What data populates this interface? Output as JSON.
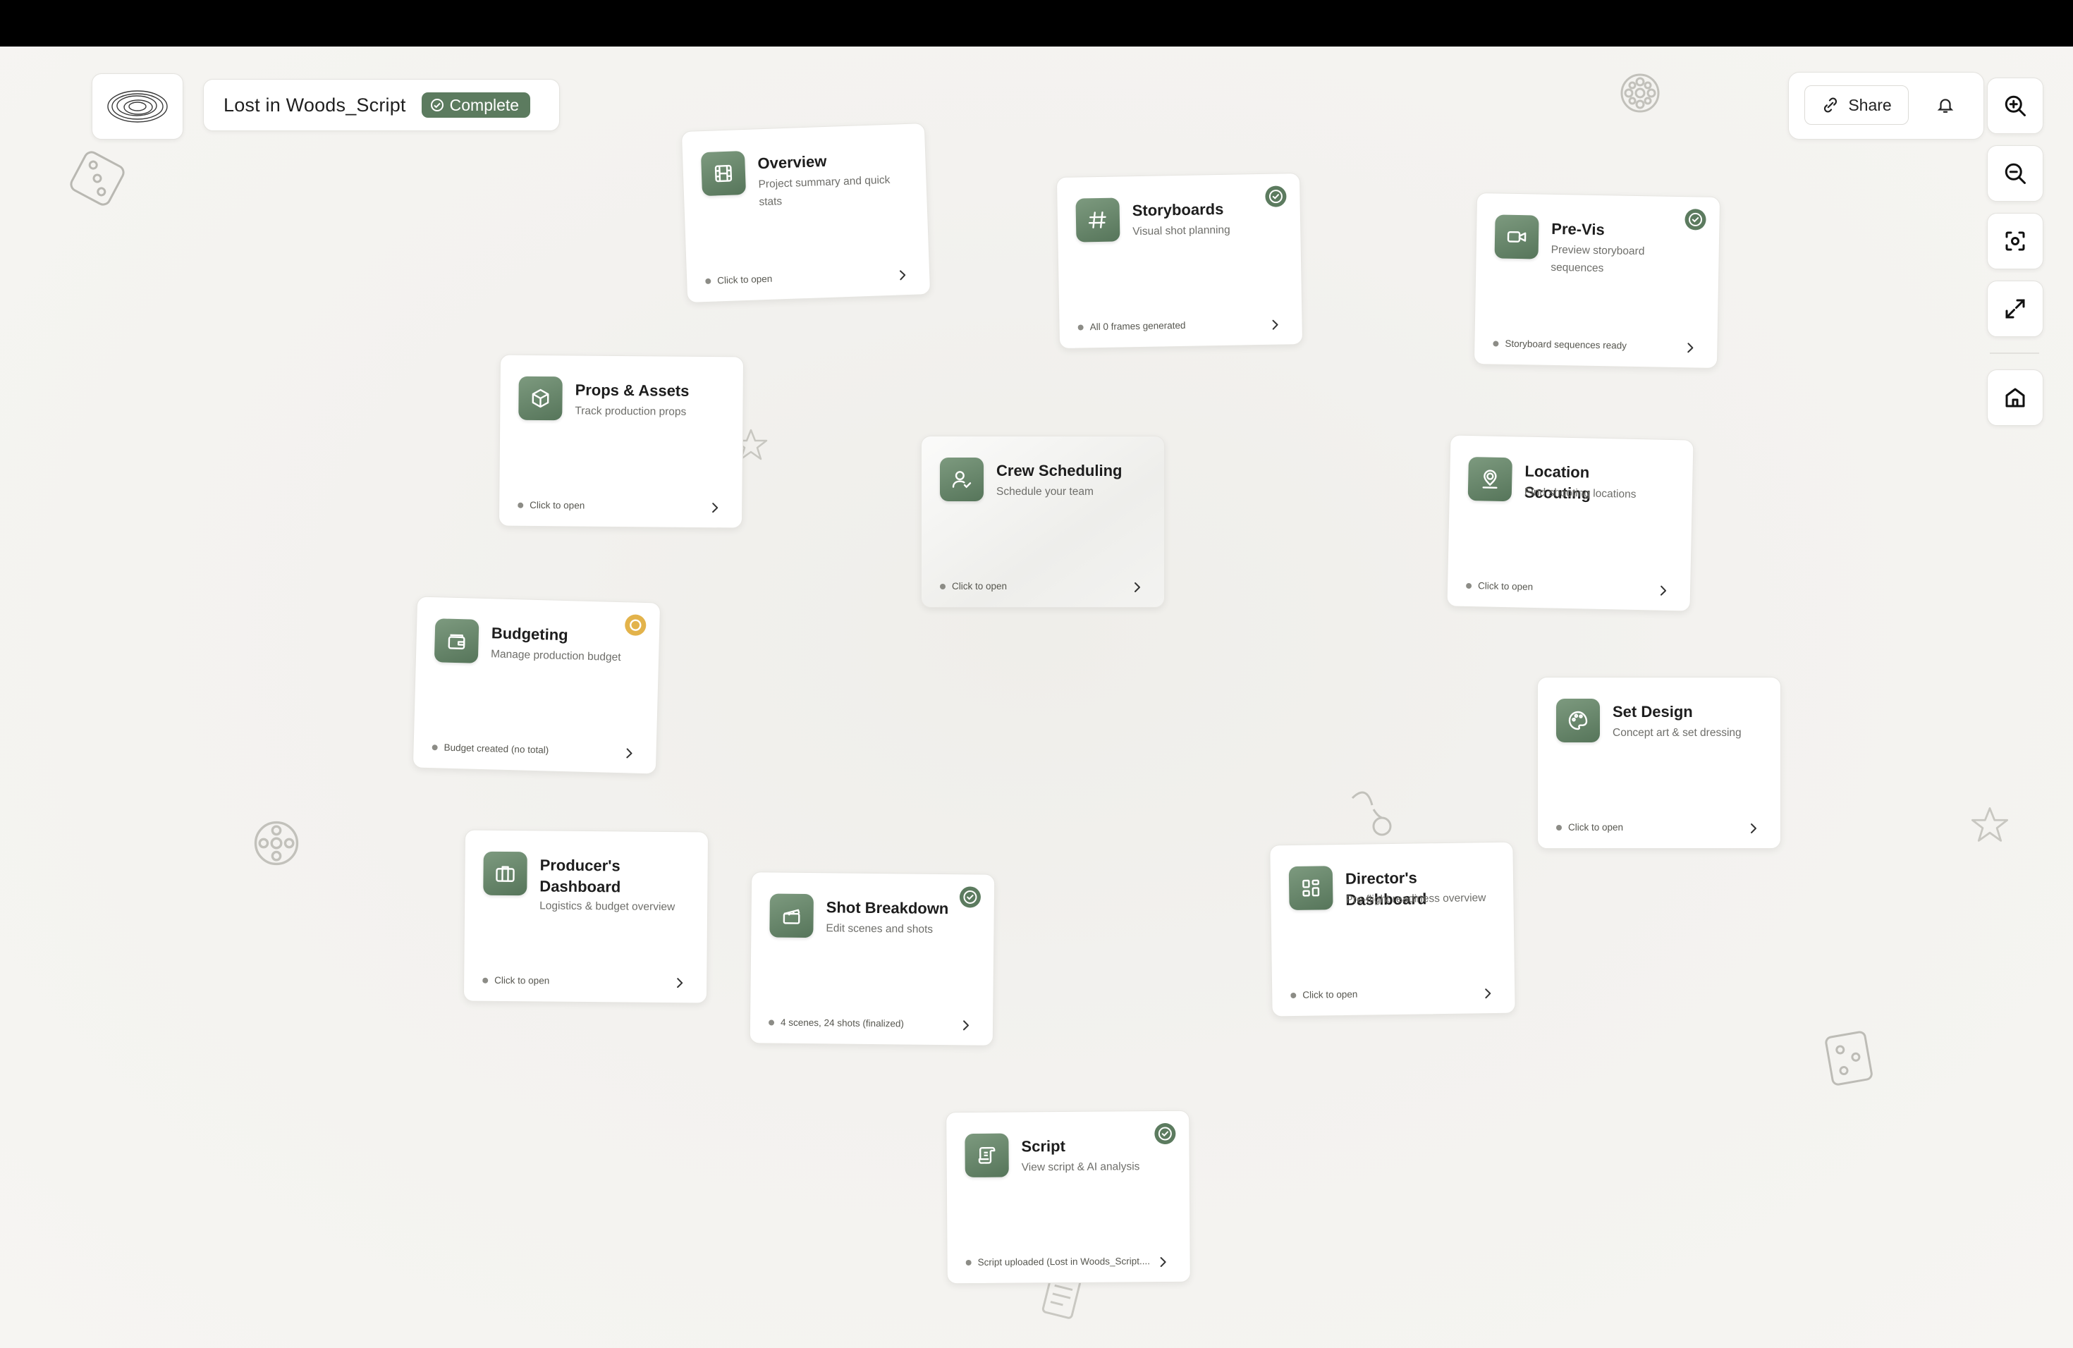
{
  "project": {
    "title": "Lost in Woods_Script",
    "status_label": "Complete"
  },
  "header": {
    "share_label": "Share"
  },
  "colors": {
    "accent": "#5c7b5f",
    "pending": "#e3b34b",
    "background": "#f3f2ef"
  },
  "toolbar": {
    "tools": [
      {
        "name": "zoom-in",
        "icon": "zoom-in-icon"
      },
      {
        "name": "zoom-out",
        "icon": "zoom-out-icon"
      },
      {
        "name": "focus",
        "icon": "focus-icon"
      },
      {
        "name": "expand",
        "icon": "expand-icon"
      },
      {
        "name": "home",
        "icon": "home-icon"
      }
    ]
  },
  "cards": {
    "overview": {
      "title": "Overview",
      "subtitle": "Project summary and quick stats",
      "footer": "Click to open",
      "icon": "film-icon"
    },
    "storyboards": {
      "title": "Storyboards",
      "subtitle": "Visual shot planning",
      "footer": "All 0 frames generated",
      "icon": "hash-icon",
      "status": "complete"
    },
    "previs": {
      "title": "Pre-Vis",
      "subtitle": "Preview storyboard sequences",
      "footer": "Storyboard sequences ready",
      "icon": "video-icon",
      "status": "complete"
    },
    "props": {
      "title": "Props & Assets",
      "subtitle": "Track production props",
      "footer": "Click to open",
      "icon": "box-icon"
    },
    "crew": {
      "title": "Crew Scheduling",
      "subtitle": "Schedule your team",
      "footer": "Click to open",
      "icon": "user-check-icon"
    },
    "location": {
      "title": "Location Scouting",
      "subtitle": "Find shooting locations",
      "footer": "Click to open",
      "icon": "map-pin-icon"
    },
    "budgeting": {
      "title": "Budgeting",
      "subtitle": "Manage production budget",
      "footer": "Budget created (no total)",
      "icon": "wallet-icon",
      "status": "in-progress"
    },
    "setdesign": {
      "title": "Set Design",
      "subtitle": "Concept art & set dressing",
      "footer": "Click to open",
      "icon": "palette-icon"
    },
    "producer": {
      "title": "Producer's Dashboard",
      "subtitle": "Logistics & budget overview",
      "footer": "Click to open",
      "icon": "briefcase-icon"
    },
    "shots": {
      "title": "Shot Breakdown",
      "subtitle": "Edit scenes and shots",
      "footer": "4 scenes, 24 shots (finalized)",
      "icon": "clapperboard-icon",
      "status": "complete"
    },
    "director": {
      "title": "Director's Dashboard",
      "subtitle": "Pre-flight readiness overview",
      "footer": "Click to open",
      "icon": "layout-grid-icon"
    },
    "script": {
      "title": "Script",
      "subtitle": "View script & AI analysis",
      "footer": "Script uploaded (Lost in Woods_Script....",
      "icon": "scroll-icon",
      "status": "complete"
    }
  }
}
